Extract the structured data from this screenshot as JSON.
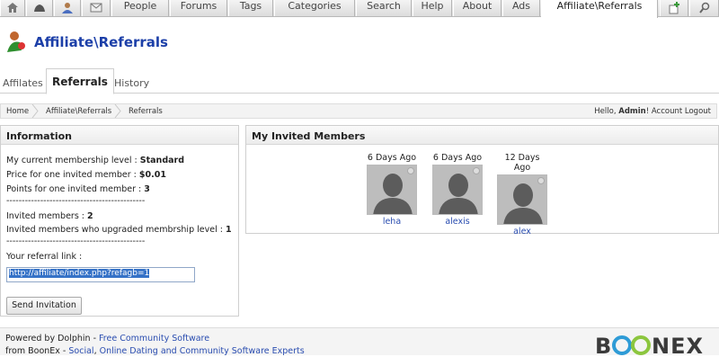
{
  "topnav": {
    "tabs": [
      {
        "label": "People"
      },
      {
        "label": "Forums"
      },
      {
        "label": "Tags"
      },
      {
        "label": "Categories"
      },
      {
        "label": "Search"
      },
      {
        "label": "Help"
      },
      {
        "label": "About"
      },
      {
        "label": "Ads"
      },
      {
        "label": "Affiliate\\Referrals"
      }
    ],
    "icons": [
      "home-icon",
      "tools-icon",
      "user-icon",
      "mail-icon",
      "add-page-icon",
      "search-icon"
    ]
  },
  "header": {
    "title": "Affiliate\\Referrals"
  },
  "subtabs": [
    {
      "label": "Affilates"
    },
    {
      "label": "Referrals"
    },
    {
      "label": "History"
    }
  ],
  "breadcrumb": {
    "items": [
      "Home",
      "Affiliate\\Referrals",
      "Referrals"
    ],
    "hello": "Hello,",
    "user": "Admin",
    "sep": "!",
    "account": "Account",
    "logout": "Logout"
  },
  "info": {
    "title": "Information",
    "level_label": "My current membership level :",
    "level_value": "Standard",
    "price_label": "Price for one invited member :",
    "price_value": "$0.01",
    "points_label": "Points for one invited member :",
    "points_value": "3",
    "divider": "---------------------------------------------",
    "invited_label": "Invited members :",
    "invited_value": "2",
    "upgraded_label": "Invited members who upgraded membrship level :",
    "upgraded_value": "1",
    "ref_label": "Your referral link :",
    "ref_link": "http://affiliate/index.php?refagb=1",
    "send_button": "Send Invitation"
  },
  "members": {
    "title": "My Invited Members",
    "list": [
      {
        "ago": "6 Days Ago",
        "name": "leha"
      },
      {
        "ago": "6 Days Ago",
        "name": "alexis"
      },
      {
        "ago": "12 Days Ago",
        "name": "alex"
      }
    ]
  },
  "footer": {
    "line1_prefix": "Powered by Dolphin - ",
    "line1_link": "Free Community Software",
    "line2_prefix": "from BoonEx - ",
    "line2_link1": "Social",
    "line2_comma": ", ",
    "line2_link2": "Online Dating and Community Software Experts",
    "logo": "BOONEX"
  },
  "colors": {
    "title_blue": "#1c3fa8",
    "link_blue": "#2a4db0",
    "selection": "#3572c7"
  }
}
